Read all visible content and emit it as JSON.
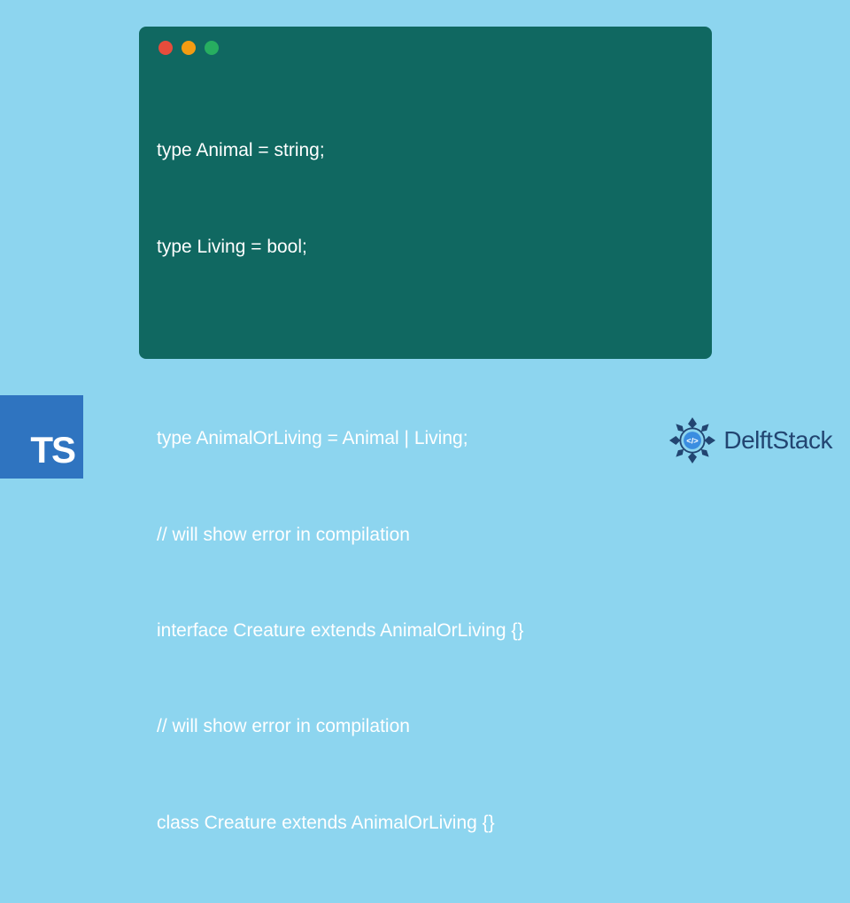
{
  "code": {
    "lines": [
      "type Animal = string;",
      "type Living = bool;",
      "",
      "type AnimalOrLiving = Animal | Living;",
      "// will show error in compilation",
      "interface Creature extends AnimalOrLiving {}",
      "// will show error in compilation",
      "class Creature extends AnimalOrLiving {}"
    ]
  },
  "badges": {
    "typescript": "TS",
    "brand": "DelftStack"
  }
}
